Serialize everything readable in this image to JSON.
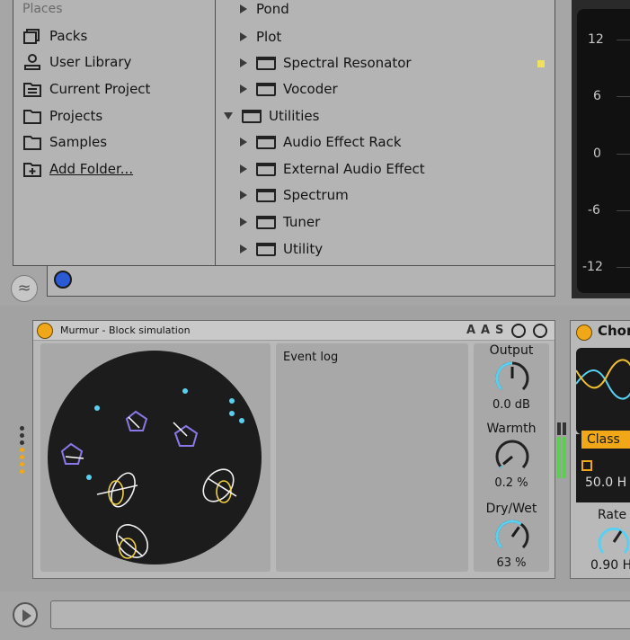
{
  "browser": {
    "places_header": "Places",
    "places": [
      {
        "label": "Packs",
        "icon": "packs-icon"
      },
      {
        "label": "User Library",
        "icon": "user-icon"
      },
      {
        "label": "Current Project",
        "icon": "project-icon"
      },
      {
        "label": "Projects",
        "icon": "folder-icon"
      },
      {
        "label": "Samples",
        "icon": "folder-icon"
      },
      {
        "label": "Add Folder...",
        "icon": "add-folder-icon"
      }
    ],
    "items": [
      {
        "label": "Pond",
        "indent": 0,
        "folder": false,
        "expanded": false
      },
      {
        "label": "Plot",
        "indent": 0,
        "folder": false,
        "expanded": false
      },
      {
        "label": "Spectral Resonator",
        "indent": 0,
        "folder": true,
        "expanded": false
      },
      {
        "label": "Vocoder",
        "indent": 0,
        "folder": true,
        "expanded": false
      },
      {
        "label": "Utilities",
        "indent": -1,
        "folder": true,
        "expanded": true
      },
      {
        "label": "Audio Effect Rack",
        "indent": 0,
        "folder": true,
        "expanded": false
      },
      {
        "label": "External Audio Effect",
        "indent": 0,
        "folder": true,
        "expanded": false
      },
      {
        "label": "Spectrum",
        "indent": 0,
        "folder": true,
        "expanded": false
      },
      {
        "label": "Tuner",
        "indent": 0,
        "folder": true,
        "expanded": false
      },
      {
        "label": "Utility",
        "indent": 0,
        "folder": true,
        "expanded": false
      }
    ],
    "accent_dot_color": "#f0e060"
  },
  "meter": {
    "labels": [
      "12",
      "6",
      "0",
      "-6",
      "-12"
    ]
  },
  "device": {
    "title": "Murmur - Block simulation",
    "header_icons": [
      "A",
      "A",
      "S"
    ],
    "event_log_title": "Event log",
    "knobs": [
      {
        "label": "Output",
        "value": "0.0 dB",
        "level": 0.5
      },
      {
        "label": "Warmth",
        "value": "0.2 %",
        "level": 0.02
      },
      {
        "label": "Dry/Wet",
        "value": "63 %",
        "level": 0.63
      }
    ],
    "accent_color": "#f0a818",
    "knob_color": "#5ad0f0"
  },
  "device2": {
    "title": "Chor",
    "mode": "Class",
    "freq": "50.0 H",
    "rate_label": "Rate",
    "rate_value": "0.90 H"
  }
}
